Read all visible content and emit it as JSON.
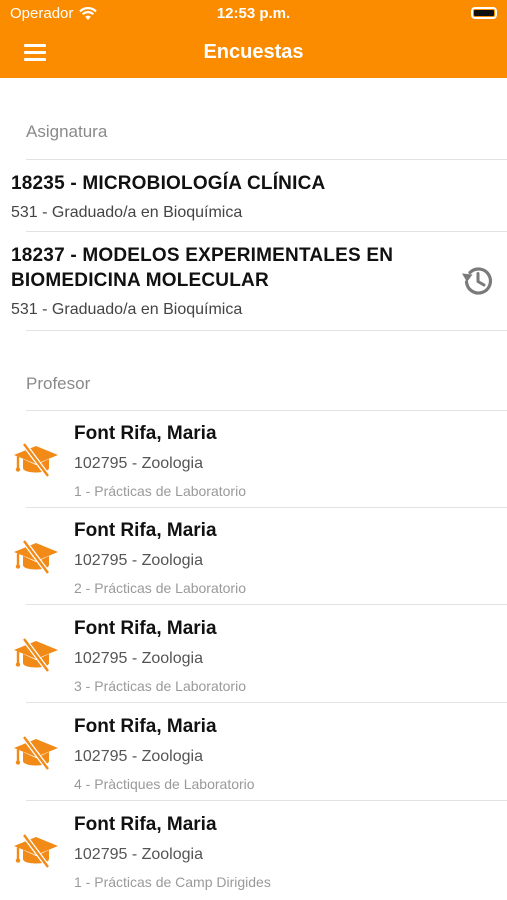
{
  "status": {
    "carrier": "Operador",
    "time": "12:53 p.m."
  },
  "nav": {
    "title": "Encuestas"
  },
  "sections": {
    "subjects_header": "Asignatura",
    "teachers_header": "Profesor"
  },
  "subjects": [
    {
      "name": "18235 - MICROBIOLOGÍA CLÍNICA",
      "degree": "531 - Graduado/a en Bioquímica"
    },
    {
      "name": "18237 - MODELOS EXPERIMENTALES EN BIOMEDICINA MOLECULAR",
      "degree": "531 - Graduado/a en Bioquímica",
      "icon": "history-icon"
    }
  ],
  "teachers": [
    {
      "name": "Font Rifa, Maria",
      "subject": "102795 - Zoologia",
      "group": "1 - Prácticas de Laboratorio",
      "icon": "graduation-cap-icon"
    },
    {
      "name": "Font Rifa, Maria",
      "subject": "102795 - Zoologia",
      "group": "2 - Prácticas de Laboratorio",
      "icon": "graduation-cap-icon"
    },
    {
      "name": "Font Rifa, Maria",
      "subject": "102795 - Zoologia",
      "group": "3 - Prácticas de Laboratorio",
      "icon": "graduation-cap-icon"
    },
    {
      "name": "Font Rifa, Maria",
      "subject": "102795 - Zoologia",
      "group": "4 - Pràctiques de Laboratorio",
      "icon": "graduation-cap-icon"
    },
    {
      "name": "Font Rifa, Maria",
      "subject": "102795 - Zoologia",
      "group": "1 - Prácticas de Camp Dirigides",
      "icon": "graduation-cap-icon"
    }
  ],
  "colors": {
    "accent": "#fb8c00",
    "icon": "#f28a18"
  }
}
